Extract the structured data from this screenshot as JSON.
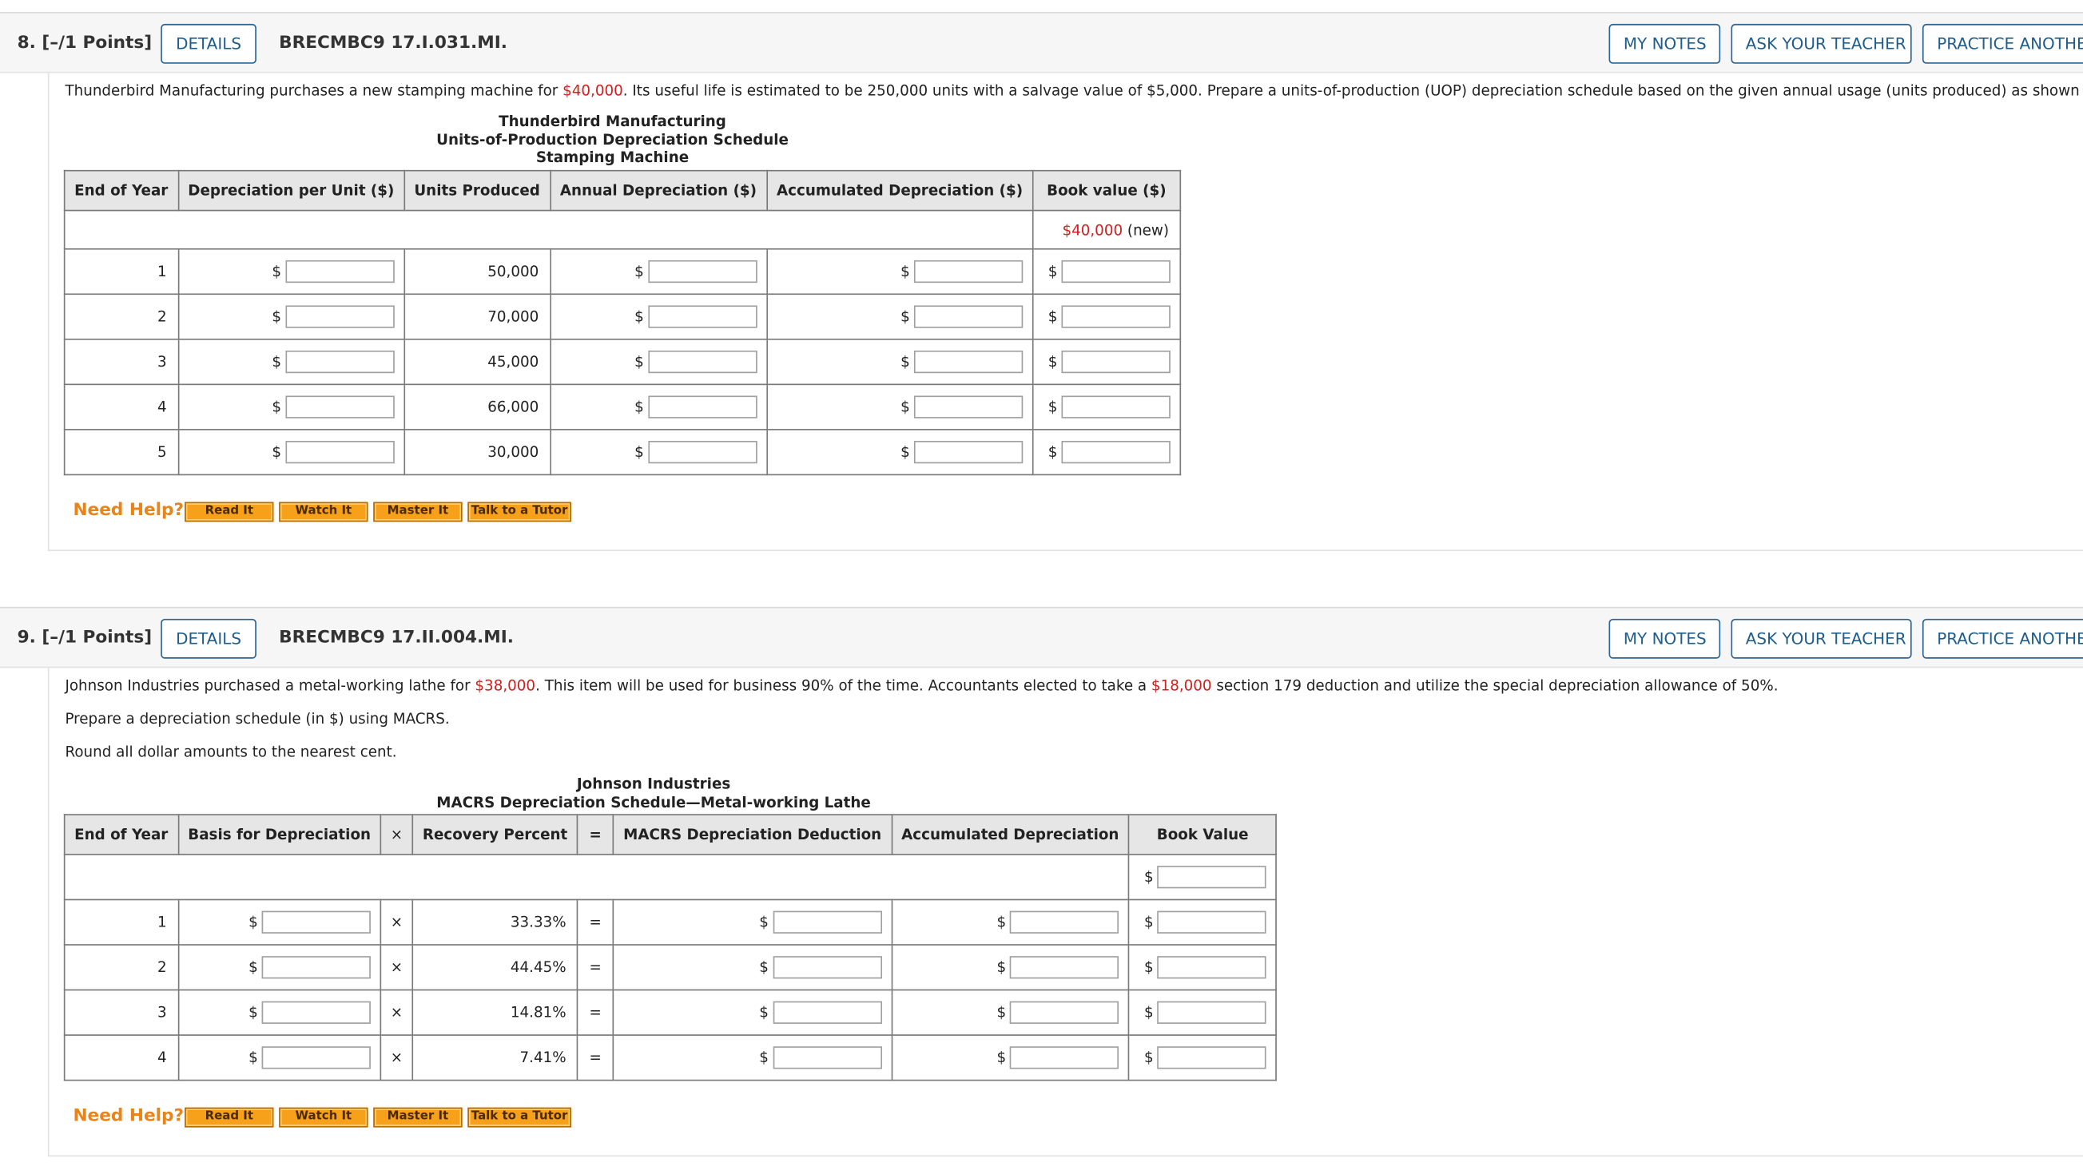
{
  "q8": {
    "number": "8.",
    "points": "[–/1 Points]",
    "details": "DETAILS",
    "code": "BRECMBC9 17.I.031.MI.",
    "my_notes": "MY NOTES",
    "ask_teacher": "ASK YOUR TEACHER",
    "practice": "PRACTICE ANOTHER",
    "text_a": "Thunderbird Manufacturing purchases a new stamping machine for ",
    "price": "$40,000",
    "text_b": ". Its useful life is estimated to be 250,000 units with a salvage value of $5,000. Prepare a units-of-production (UOP) depreciation schedule based on the given annual usage (units produced) as shown below.",
    "title1": "Thunderbird Manufacturing",
    "title2": "Units-of-Production Depreciation Schedule",
    "title3": "Stamping Machine",
    "headers": [
      "End of Year",
      "Depreciation per Unit ($)",
      "Units Produced",
      "Annual Depreciation ($)",
      "Accumulated Depreciation ($)",
      "Book value ($)"
    ],
    "initial_book_value": "$40,000",
    "initial_suffix": "(new)",
    "dollar": "$",
    "rows": [
      {
        "year": "1",
        "units": "50,000"
      },
      {
        "year": "2",
        "units": "70,000"
      },
      {
        "year": "3",
        "units": "45,000"
      },
      {
        "year": "4",
        "units": "66,000"
      },
      {
        "year": "5",
        "units": "30,000"
      }
    ]
  },
  "q9": {
    "number": "9.",
    "points": "[–/1 Points]",
    "details": "DETAILS",
    "code": "BRECMBC9 17.II.004.MI.",
    "my_notes": "MY NOTES",
    "ask_teacher": "ASK YOUR TEACHER",
    "practice": "PRACTICE ANOTHER",
    "text_a": "Johnson Industries purchased a metal-working lathe for ",
    "price": "$38,000",
    "text_b": ". This item will be used for business 90% of the time. Accountants elected to take a ",
    "deduction": "$18,000",
    "text_c": " section 179 deduction and utilize the special depreciation allowance of 50%.",
    "line2": "Prepare a depreciation schedule (in $) using MACRS.",
    "line3": "Round all dollar amounts to the nearest cent.",
    "title1": "Johnson Industries",
    "title2": "MACRS Depreciation Schedule—Metal-working Lathe",
    "headers": [
      "End of Year",
      "Basis for Depreciation",
      "×",
      "Recovery Percent",
      "=",
      "MACRS Depreciation Deduction",
      "Accumulated Depreciation",
      "Book Value"
    ],
    "dollar": "$",
    "times": "×",
    "equals": "=",
    "rows": [
      {
        "year": "1",
        "percent": "33.33%"
      },
      {
        "year": "2",
        "percent": "44.45%"
      },
      {
        "year": "3",
        "percent": "14.81%"
      },
      {
        "year": "4",
        "percent": "7.41%"
      }
    ]
  },
  "help": {
    "label": "Need Help?",
    "read": "Read It",
    "watch": "Watch It",
    "master": "Master It",
    "tutor": "Talk to a Tutor"
  }
}
